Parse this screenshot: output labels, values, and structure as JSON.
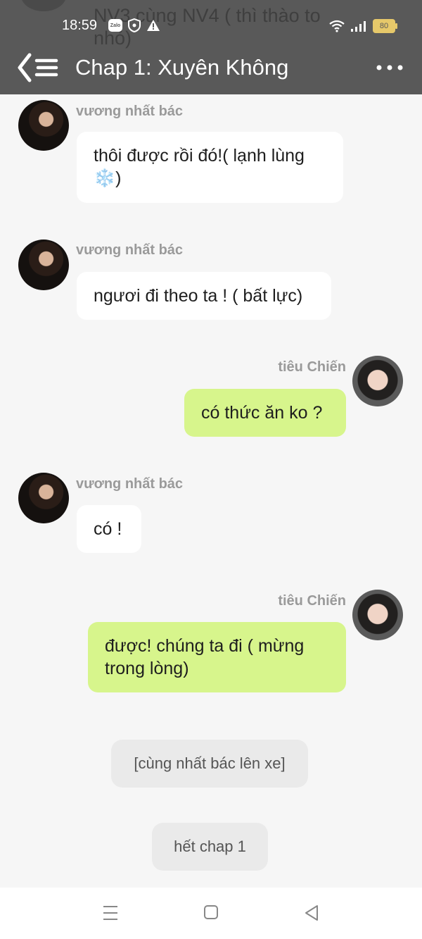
{
  "status_bar": {
    "time": "18:59",
    "battery": "80",
    "zalo_label": "Zalo"
  },
  "header": {
    "title": "Chap 1: Xuyên Không",
    "ghost_text": "NV3 cùng NV4 ( thì thào to nhỏ)"
  },
  "messages": [
    {
      "sender": "vương nhất bác",
      "text": "thôi được rồi đó!( lạnh lùng ❄️)",
      "side": "left"
    },
    {
      "sender": "vương nhất bác",
      "text": "ngươi đi theo ta ! ( bất lực)",
      "side": "left"
    },
    {
      "sender": "tiêu Chiến",
      "text": "có thức ăn ko ?",
      "side": "right"
    },
    {
      "sender": "vương nhất bác",
      "text": "có !",
      "side": "left"
    },
    {
      "sender": "tiêu Chiến",
      "text": "được! chúng ta đi ( mừng trong lòng)",
      "side": "right"
    }
  ],
  "system_messages": [
    "[cùng nhất bác lên xe]",
    "hết chap 1"
  ],
  "colors": {
    "header_bg": "#595959",
    "self_bubble": "#d7f58c",
    "other_bubble": "#ffffff",
    "page_bg": "#f6f6f6"
  },
  "icons": {
    "back": "back-menu-icon",
    "more": "more-dots-icon",
    "nav_menu": "menu-icon",
    "nav_home": "home-square-icon",
    "nav_back": "back-triangle-icon"
  }
}
